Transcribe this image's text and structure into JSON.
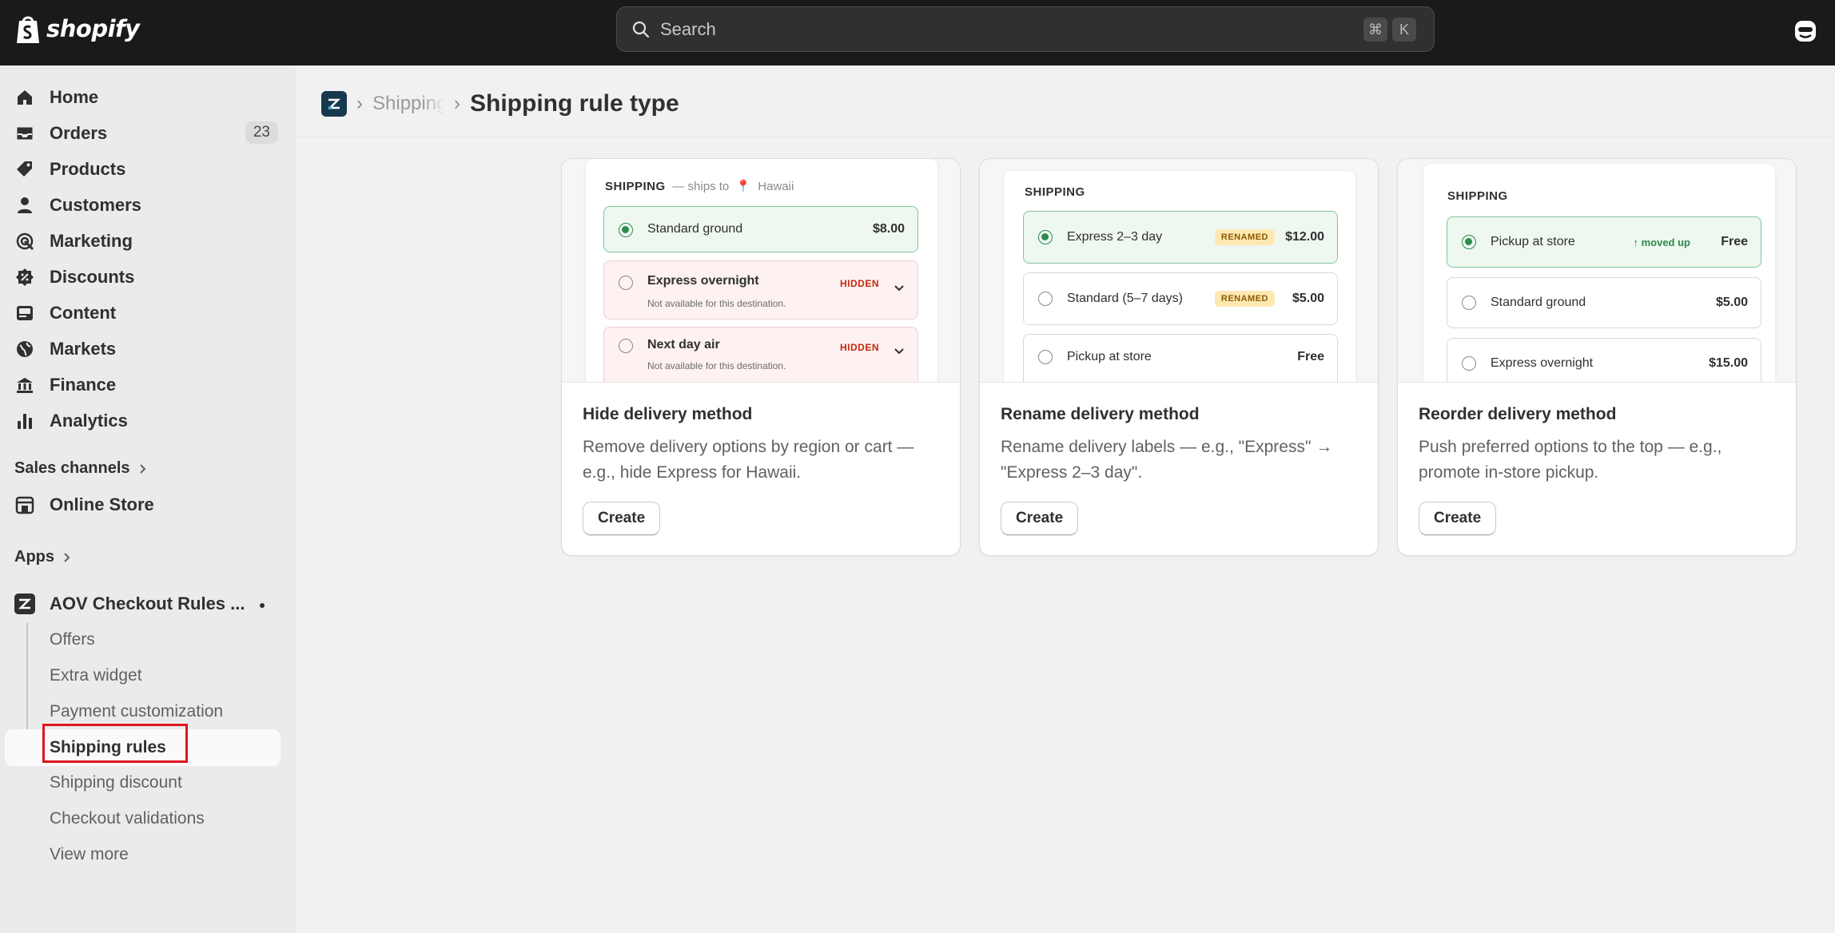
{
  "topbar": {
    "brand": "shopify",
    "search_placeholder": "Search",
    "shortcut_cmd": "⌘",
    "shortcut_key": "K"
  },
  "sidebar": {
    "nav": [
      {
        "label": "Home",
        "icon": "home-icon"
      },
      {
        "label": "Orders",
        "icon": "inbox-icon",
        "badge": "23"
      },
      {
        "label": "Products",
        "icon": "tag-icon"
      },
      {
        "label": "Customers",
        "icon": "person-icon"
      },
      {
        "label": "Marketing",
        "icon": "target-icon"
      },
      {
        "label": "Discounts",
        "icon": "discount-icon"
      },
      {
        "label": "Content",
        "icon": "image-icon"
      },
      {
        "label": "Markets",
        "icon": "globe-icon"
      },
      {
        "label": "Finance",
        "icon": "bank-icon"
      },
      {
        "label": "Analytics",
        "icon": "bar-chart-icon"
      }
    ],
    "sales_channels_label": "Sales channels",
    "online_store_label": "Online Store",
    "apps_label": "Apps",
    "app_name": "AOV Checkout Rules ...",
    "app_sub_items": [
      "Offers",
      "Extra widget",
      "Payment customization",
      "Shipping rules",
      "Shipping discount",
      "Checkout validations",
      "View more"
    ]
  },
  "breadcrumb": {
    "parent": "Shipping rules",
    "title": "Shipping rule type"
  },
  "cards": [
    {
      "title": "Hide delivery method",
      "description": "Remove delivery options by region or cart — e.g., hide Express for Hawaii.",
      "button": "Create",
      "preview": {
        "heading": "SHIPPING",
        "ships_to_label": "— ships to",
        "destination": "Hawaii",
        "options": [
          {
            "name": "Standard ground",
            "price": "$8.00"
          },
          {
            "name": "Express overnight",
            "tag": "HIDDEN",
            "note": "Not available for this destination."
          },
          {
            "name": "Next day air",
            "tag": "HIDDEN",
            "note": "Not available for this destination."
          }
        ]
      }
    },
    {
      "title": "Rename delivery method",
      "description": "Rename delivery labels — e.g., \"Express\" → \"Express 2–3 day\".",
      "button": "Create",
      "preview": {
        "heading": "SHIPPING",
        "options": [
          {
            "name": "Express 2–3 day",
            "tag": "RENAMED",
            "price": "$12.00"
          },
          {
            "name": "Standard (5–7 days)",
            "tag": "RENAMED",
            "price": "$5.00"
          },
          {
            "name": "Pickup at store",
            "price": "Free"
          }
        ]
      }
    },
    {
      "title": "Reorder delivery method",
      "description": "Push preferred options to the top — e.g., promote in-store pickup.",
      "button": "Create",
      "preview": {
        "heading": "SHIPPING",
        "options": [
          {
            "name": "Pickup at store",
            "tag": "↑ moved up",
            "price": "Free"
          },
          {
            "name": "Standard ground",
            "price": "$5.00"
          },
          {
            "name": "Express overnight",
            "price": "$15.00"
          }
        ]
      }
    }
  ],
  "colors": {
    "topbar": "#1a1a1a",
    "selected_green": "#2d8a4e",
    "hidden_red": "#c5280c",
    "highlight_box": "#e1141c"
  }
}
